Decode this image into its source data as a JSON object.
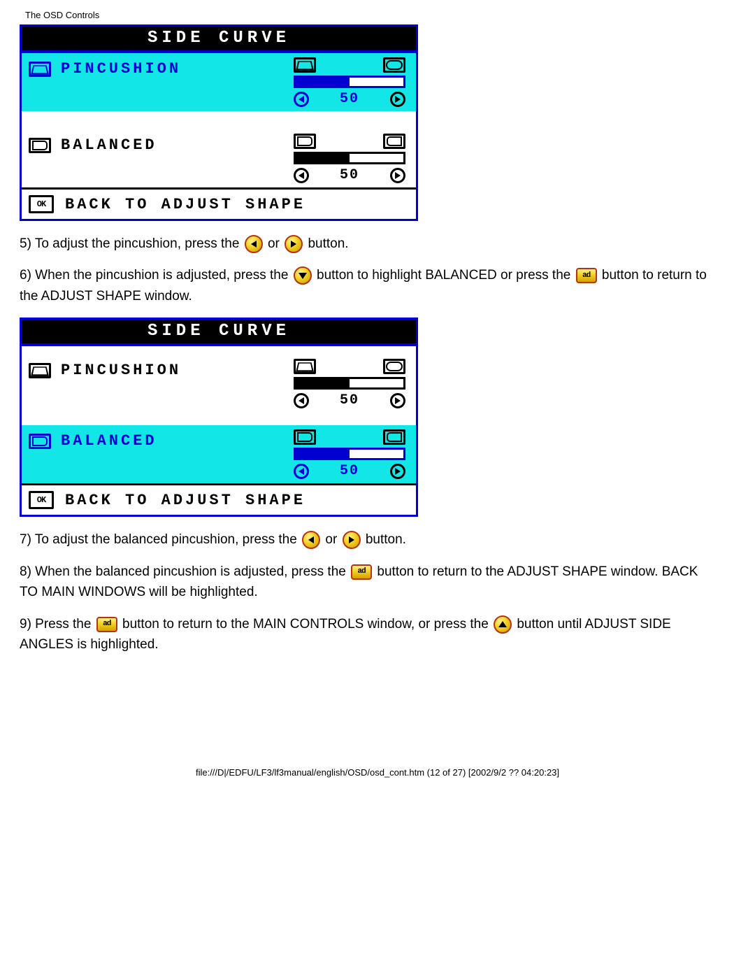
{
  "header": {
    "title": "The OSD Controls"
  },
  "panels": [
    {
      "title": "SIDE CURVE",
      "rows": [
        {
          "label": "PINCUSHION",
          "value": "50",
          "gauge_pct": 50,
          "highlighted": true
        },
        {
          "label": "BALANCED",
          "value": "50",
          "gauge_pct": 50,
          "highlighted": false
        }
      ],
      "footer": "BACK TO ADJUST SHAPE"
    },
    {
      "title": "SIDE CURVE",
      "rows": [
        {
          "label": "PINCUSHION",
          "value": "50",
          "gauge_pct": 50,
          "highlighted": false
        },
        {
          "label": "BALANCED",
          "value": "50",
          "gauge_pct": 50,
          "highlighted": true
        }
      ],
      "footer": "BACK TO ADJUST SHAPE"
    }
  ],
  "instructions": {
    "s5a": "5) To adjust the pincushion, press the ",
    "s5b": " or ",
    "s5c": " button.",
    "s6a": "6) When the pincushion is adjusted, press the ",
    "s6b": " button to highlight BALANCED or press the ",
    "s6c": " button to return to the ADJUST SHAPE window.",
    "s7a": "7) To adjust the balanced pincushion, press the ",
    "s7b": " or ",
    "s7c": " button.",
    "s8a": "8) When the balanced pincushion is adjusted, press the ",
    "s8b": " button to return to the ADJUST SHAPE window. BACK TO MAIN WINDOWS will be highlighted.",
    "s9a": "9) Press the ",
    "s9b": " button to return to the MAIN CONTROLS window, or press the ",
    "s9c": " button until ADJUST SIDE ANGLES is highlighted."
  },
  "footer_line": "file:///D|/EDFU/LF3/lf3manual/english/OSD/osd_cont.htm (12 of 27) [2002/9/2 ?? 04:20:23]"
}
